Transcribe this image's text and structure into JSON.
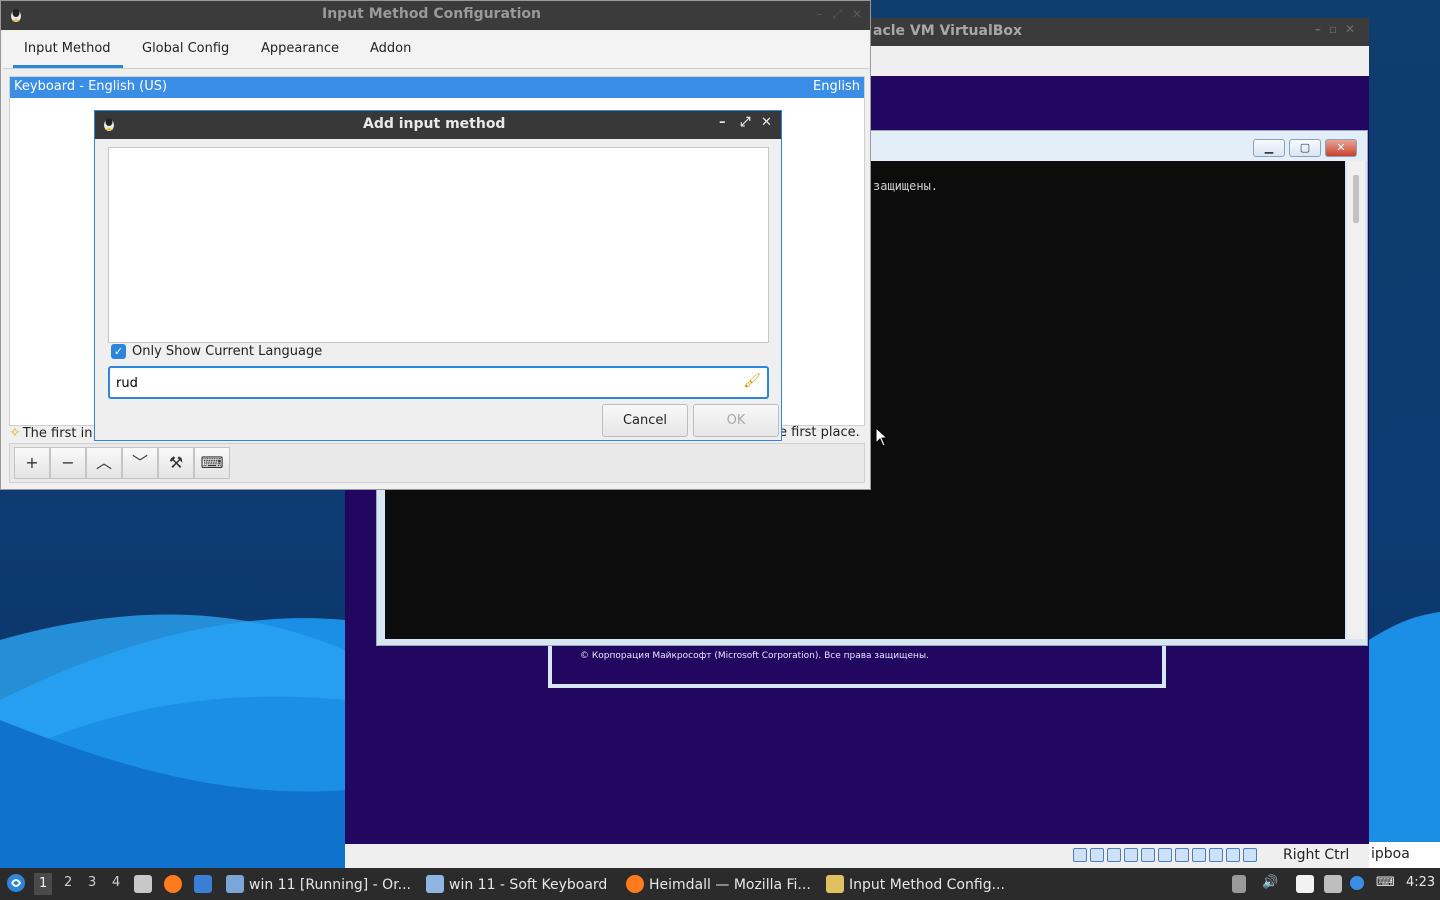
{
  "imcfg": {
    "title": "Input Method Configuration",
    "tabs": [
      "Input Method",
      "Global Config",
      "Appearance",
      "Addon"
    ],
    "selected_row": {
      "name": "Keyboard - English (US)",
      "language": "English"
    },
    "hint_left": "The first in",
    "hint_right": "e first place.",
    "toolbar": {
      "add": "+",
      "remove": "−",
      "up": "︿",
      "down": "﹀",
      "configure": "⚒",
      "keyboard": "⌨"
    }
  },
  "dialog": {
    "title": "Add input method",
    "only_current_language_label": "Only Show Current Language",
    "only_current_language_checked": true,
    "search_value": "rud",
    "cancel_label": "Cancel",
    "ok_label": "OK",
    "min": "–",
    "max": "⤢",
    "close": "✕"
  },
  "vbox": {
    "title": "acle VM VirtualBox",
    "host_key": "Right Ctrl",
    "console_line": "защищены.",
    "copyright": "© Корпорация Майкрософт (Microsoft Corporation). Все права защищены.",
    "side_label": "ipboa"
  },
  "taskbar": {
    "workspaces": [
      "1",
      "2",
      "3",
      "4"
    ],
    "items": [
      {
        "label": "win 11 [Running] - Or...",
        "icon": "virtualbox-icon"
      },
      {
        "label": "win 11 - Soft Keyboard",
        "icon": "keyboard-icon"
      },
      {
        "label": "Heimdall — Mozilla Fi...",
        "icon": "firefox-icon"
      },
      {
        "label": "Input Method Config...",
        "icon": "fcitx-icon"
      }
    ],
    "clock": "4:23"
  },
  "colors": {
    "accent": "#2d86d9",
    "titlebar": "#3b3b3b",
    "taskbar": "#2b2b2b"
  }
}
